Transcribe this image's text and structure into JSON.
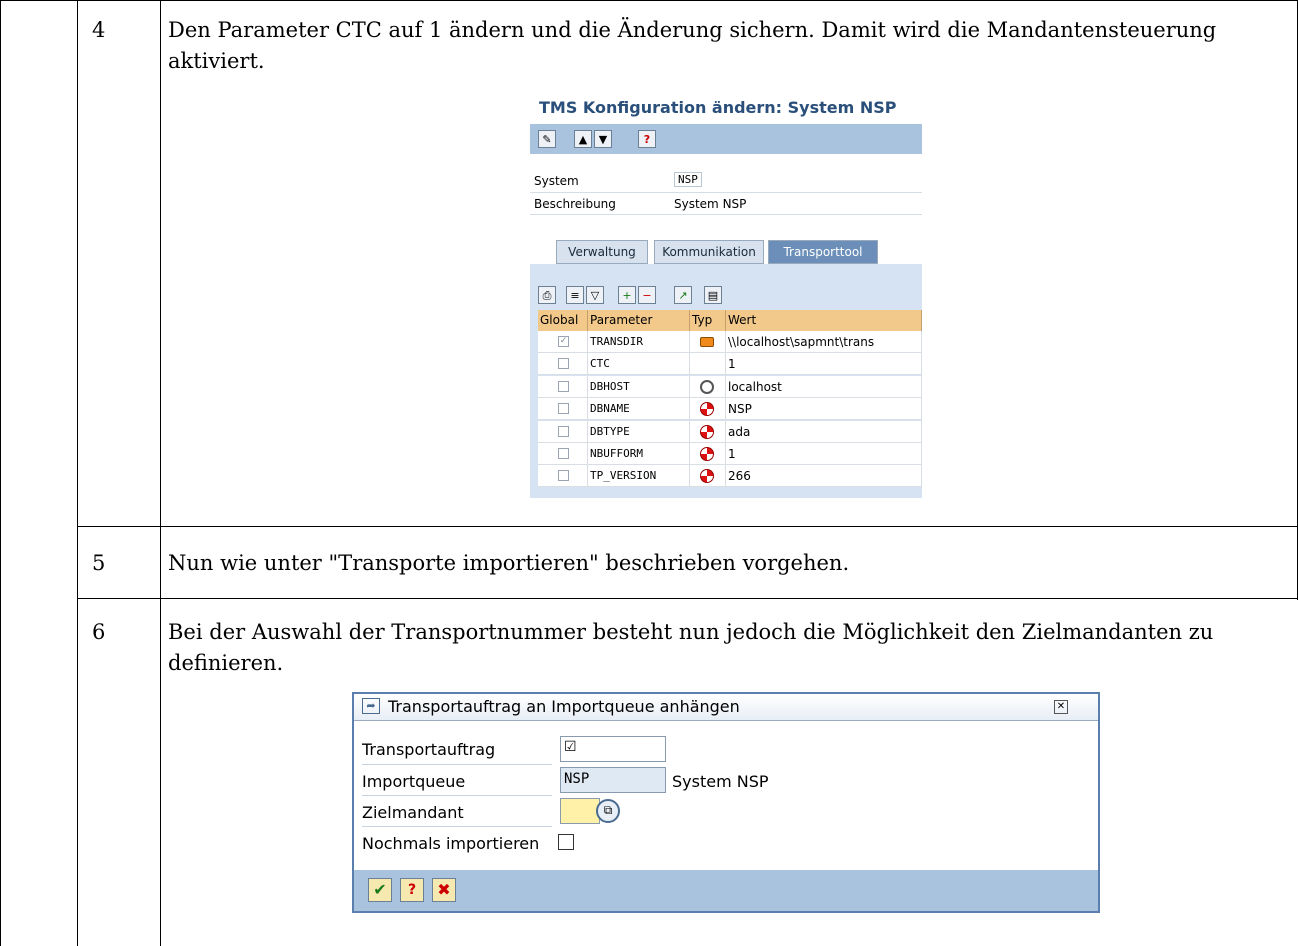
{
  "rows": [
    {
      "num": "4",
      "text": "Den Parameter CTC auf 1 ändern und die Änderung sichern. Damit wird die Mandantensteuerung aktiviert."
    },
    {
      "num": "5",
      "text": "Nun wie unter \"Transporte importieren\" beschrieben vorgehen."
    },
    {
      "num": "6",
      "text": "Bei der Auswahl der Transportnummer besteht nun jedoch die Möglichkeit den Zielmandanten zu definieren."
    }
  ],
  "tms": {
    "title": "TMS Konfiguration ändern: System NSP",
    "fields": [
      {
        "label": "System",
        "value": "NSP"
      },
      {
        "label": "Beschreibung",
        "value": "System NSP"
      }
    ],
    "tabs": [
      "Verwaltung",
      "Kommunikation",
      "Transporttool"
    ],
    "columns": [
      "Global",
      "Parameter",
      "Typ",
      "Wert"
    ],
    "params": [
      {
        "name": "TRANSDIR",
        "value": "\\\\localhost\\sapmnt\\trans",
        "checked": true,
        "type": "folder-icon"
      },
      {
        "name": "CTC",
        "value": "1",
        "checked": false,
        "type": ""
      },
      {
        "name": "DBHOST",
        "value": "localhost",
        "checked": false,
        "type": "network-icon"
      },
      {
        "name": "DBNAME",
        "value": "NSP",
        "checked": false,
        "type": "lifebuoy-icon"
      },
      {
        "name": "DBTYPE",
        "value": "ada",
        "checked": false,
        "type": "lifebuoy-icon"
      },
      {
        "name": "NBUFFORM",
        "value": "1",
        "checked": false,
        "type": "lifebuoy-icon"
      },
      {
        "name": "TP_VERSION",
        "value": "266",
        "checked": false,
        "type": "lifebuoy-icon"
      }
    ]
  },
  "dialog": {
    "title": "Transportauftrag an Importqueue anhängen",
    "fields": [
      {
        "label": "Transportauftrag",
        "value": ""
      },
      {
        "label": "Importqueue",
        "value": "NSP",
        "desc": "System NSP"
      },
      {
        "label": "Zielmandant",
        "value": ""
      },
      {
        "label": "Nochmals importieren",
        "value": ""
      }
    ]
  },
  "colors": {
    "sap_blue": "#a9c3df",
    "title_blue": "#2a4f7a",
    "grid_header": "#f2c98a"
  }
}
